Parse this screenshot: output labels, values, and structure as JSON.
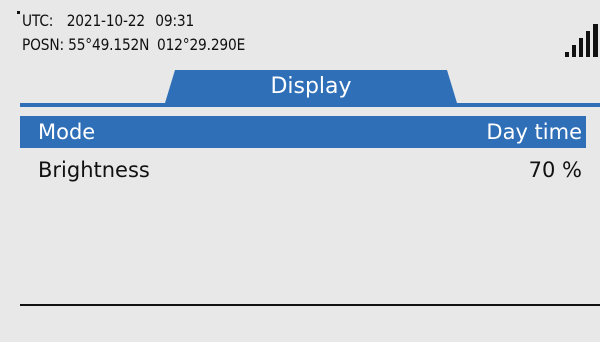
{
  "status": {
    "utc_label": "UTC:",
    "utc_date": "2021-10-22",
    "utc_time": "09:31",
    "posn_label": "POSN:",
    "lat": "55°49.152N",
    "lon": "012°29.290E",
    "signal_icon": "signal-strength-icon",
    "signal_bars": 5
  },
  "tab": {
    "label": "Display",
    "color": "#2f6fb7"
  },
  "menu": {
    "items": [
      {
        "label": "Mode",
        "value": "Day time",
        "selected": true
      },
      {
        "label": "Brightness",
        "value": "70 %",
        "selected": false
      }
    ]
  },
  "colors": {
    "accent": "#2f6fb7",
    "background": "#e8e8e8",
    "text": "#111111"
  }
}
